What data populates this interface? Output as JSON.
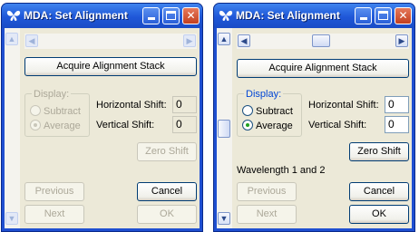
{
  "windows": [
    {
      "state": "disabled",
      "title": "MDA: Set Alignment",
      "acquire_label": "Acquire Alignment Stack",
      "display_label": "Display:",
      "subtract_label": "Subtract",
      "average_label": "Average",
      "selected_mode": "Average",
      "hshift_label": "Horizontal Shift:",
      "hshift_value": "0",
      "vshift_label": "Vertical Shift:",
      "vshift_value": "0",
      "zero_shift_label": "Zero Shift",
      "wavelength_text": "",
      "previous_label": "Previous",
      "next_label": "Next",
      "cancel_label": "Cancel",
      "ok_label": "OK"
    },
    {
      "state": "enabled",
      "title": "MDA: Set Alignment",
      "acquire_label": "Acquire Alignment Stack",
      "display_label": "Display:",
      "subtract_label": "Subtract",
      "average_label": "Average",
      "selected_mode": "Average",
      "hshift_label": "Horizontal Shift:",
      "hshift_value": "0",
      "vshift_label": "Vertical Shift:",
      "vshift_value": "0",
      "zero_shift_label": "Zero Shift",
      "wavelength_text": "Wavelength 1 and 2",
      "previous_label": "Previous",
      "next_label": "Next",
      "cancel_label": "Cancel",
      "ok_label": "OK"
    }
  ],
  "icons": {
    "app": "mda-butterfly-icon",
    "minimize": "minimize-icon",
    "maximize": "maximize-icon",
    "close": "close-icon",
    "left_arrow": "arrow-left-icon",
    "right_arrow": "arrow-right-icon",
    "up_arrow": "arrow-up-icon",
    "down_arrow": "arrow-down-icon"
  },
  "colors": {
    "titlebar": "#1f57d8",
    "close_button": "#c3401f",
    "dialog_face": "#ece9d8",
    "group_label": "#0046d5",
    "disabled_text": "#aca899"
  }
}
